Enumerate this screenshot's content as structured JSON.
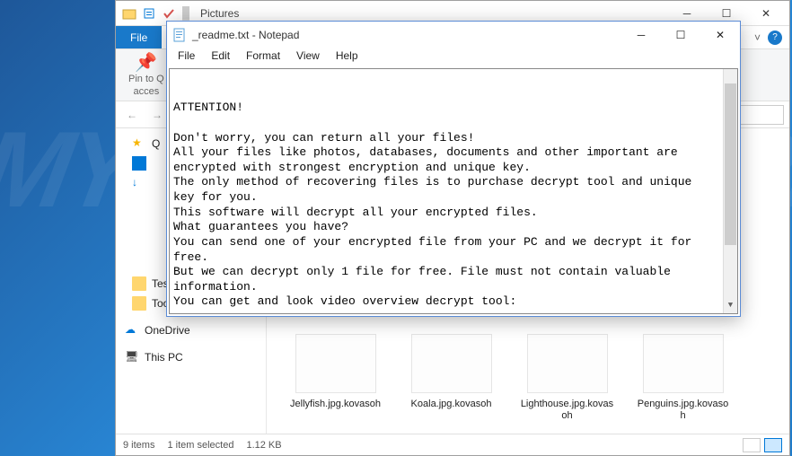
{
  "explorer": {
    "title": "Pictures",
    "file_tab": "File",
    "pin_label_line1": "Pin to Q",
    "pin_label_line2": "acces",
    "nav_back": "←",
    "nav_fwd": "→",
    "nav_up": "↑",
    "nav": {
      "quick_access": "Q",
      "desktop": "",
      "downloads": "",
      "test": "Test",
      "tools": "Tools",
      "onedrive": "OneDrive",
      "this_pc": "This PC"
    },
    "files": [
      {
        "name": "Jellyfish.jpg.kovasoh"
      },
      {
        "name": "Koala.jpg.kovasoh"
      },
      {
        "name": "Lighthouse.jpg.kovasoh"
      },
      {
        "name": "Penguins.jpg.kovasoh"
      }
    ],
    "status_count": "9 items",
    "status_selected": "1 item selected",
    "status_size": "1.12 KB"
  },
  "notepad": {
    "title": "_readme.txt - Notepad",
    "menu": [
      "File",
      "Edit",
      "Format",
      "View",
      "Help"
    ],
    "content": "ATTENTION!\n\nDon't worry, you can return all your files!\nAll your files like photos, databases, documents and other important are\nencrypted with strongest encryption and unique key.\nThe only method of recovering files is to purchase decrypt tool and unique\nkey for you.\nThis software will decrypt all your encrypted files.\nWhat guarantees you have?\nYou can send one of your encrypted file from your PC and we decrypt it for\nfree.\nBut we can decrypt only 1 file for free. File must not contain valuable\ninformation.\nYou can get and look video overview decrypt tool:"
  },
  "watermark": "MYANTISPYWARE.C"
}
